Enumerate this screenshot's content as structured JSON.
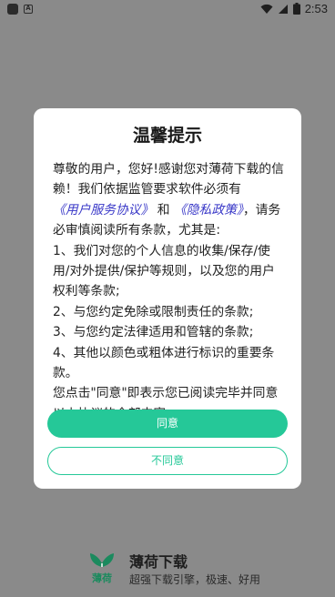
{
  "status_bar": {
    "time": "2:53",
    "icons": [
      "app-notification-icon",
      "a-notification-icon",
      "wifi-icon",
      "signal-icon",
      "battery-icon"
    ]
  },
  "dialog": {
    "title": "温馨提示",
    "body": {
      "p1_text1": "尊敬的用户，您好!感谢您对薄荷下载的信赖！我们依据监管要求软件必须有",
      "link_user_agreement": "《用户服务协议》",
      "p1_and": "和",
      "link_privacy": "《隐私政策》",
      "p1_text2": "，请务必审慎阅读所有条款，尤其是:",
      "item1": "1、我们对您的个人信息的收集/保存/使用/对外提供/保护等规则，以及您的用户权利等条款;",
      "item2": "2、与您约定免除或限制责任的条款;",
      "item3": "3、与您约定法律适用和管辖的条款;",
      "item4": "4、其他以颜色或粗体进行标识的重要条款。",
      "closing": "您点击\"同意\"即表示您已阅读完毕并同意以上协议的全部内容。"
    },
    "agree_label": "同意",
    "disagree_label": "不同意"
  },
  "brand": {
    "name": "薄荷下载",
    "slogan": "超强下载引擎，极速、好用",
    "logo_text": "薄荷"
  },
  "colors": {
    "accent": "#25c898",
    "link": "#3a39c8",
    "overlay": "#8a8a8a"
  }
}
